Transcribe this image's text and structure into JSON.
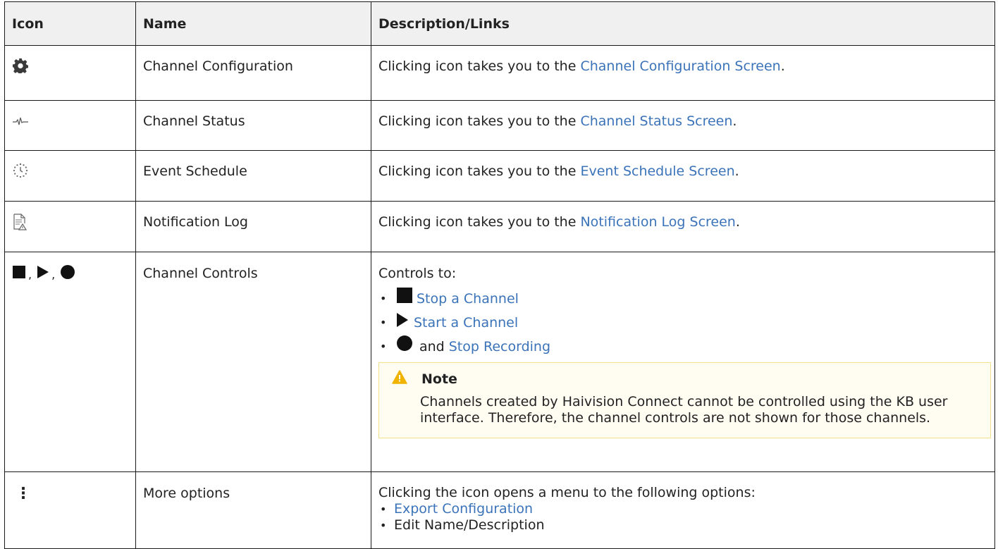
{
  "headers": [
    "Icon",
    "Name",
    "Description/Links"
  ],
  "rows": [
    {
      "name": "Channel Configuration",
      "icon": "gear-icon",
      "prefix": "Clicking icon takes you to the ",
      "link": "Channel Configuration Screen",
      "suffix": "."
    },
    {
      "name": "Channel Status",
      "icon": "pulse-icon",
      "prefix": "Clicking icon takes you to the ",
      "link": "Channel Status Screen",
      "suffix": "."
    },
    {
      "name": "Event Schedule",
      "icon": "schedule-clock-icon",
      "prefix": "Clicking icon takes you to the ",
      "link": "Event Schedule Screen",
      "suffix": "."
    },
    {
      "name": "Notification Log",
      "icon": "log-warning-icon",
      "prefix": "Clicking icon takes you to the ",
      "link": "Notification Log Screen",
      "suffix": "."
    }
  ],
  "controls": {
    "name": "Channel Controls",
    "icon_sep": ",",
    "intro": "Controls to:",
    "stop_link": "Stop a Channel",
    "start_link": "Start a Channel",
    "record_and": "and",
    "record_link": "Stop Recording",
    "bullet": "•",
    "note": {
      "title": "Note",
      "body": "Channels created by Haivision Connect cannot be controlled using the KB user interface. Therefore, the channel controls are not shown for those channels."
    }
  },
  "more": {
    "name": "More options",
    "icon_glyph": "⋮",
    "intro": "Clicking the icon opens a menu to the following options:",
    "bullet": "•",
    "export_link": "Export Configuration",
    "edit": "Edit Name/Description"
  },
  "colors": {
    "link": "#3b73b9",
    "header_bg": "#f0f0f0",
    "note_bg": "#fffdf2",
    "note_border": "#f4e08a",
    "warning": "#f0b400"
  }
}
